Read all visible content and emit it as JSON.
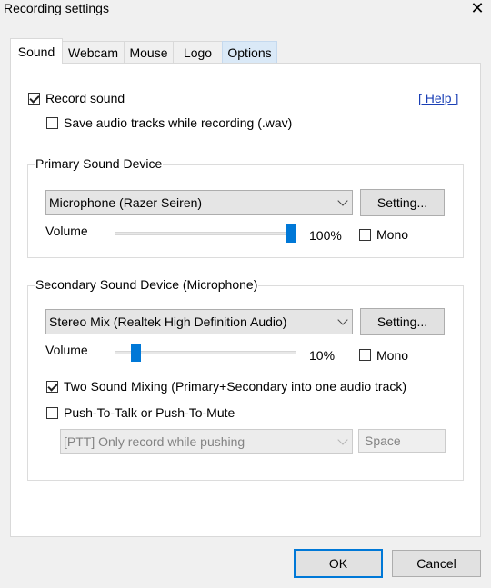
{
  "window": {
    "title": "Recording settings",
    "close_glyph": "✕"
  },
  "tabs": [
    {
      "label": "Sound",
      "active": true
    },
    {
      "label": "Webcam"
    },
    {
      "label": "Mouse"
    },
    {
      "label": "Logo"
    },
    {
      "label": "Options",
      "hover": true
    }
  ],
  "sound": {
    "record_sound": {
      "label": "Record sound",
      "checked": true
    },
    "save_wav": {
      "label": "Save audio tracks while recording (.wav)",
      "checked": false
    },
    "help_link": "[ Help ]",
    "primary": {
      "title": "Primary Sound Device",
      "device": "Microphone (Razer Seiren)",
      "setting_label": "Setting...",
      "volume_label": "Volume",
      "volume_value": "100%",
      "volume_level": 1.0,
      "mono": {
        "label": "Mono",
        "checked": false
      }
    },
    "secondary": {
      "title": "Secondary Sound Device (Microphone)",
      "device": "Stereo Mix (Realtek High Definition Audio)",
      "setting_label": "Setting...",
      "volume_label": "Volume",
      "volume_value": "10%",
      "volume_level": 0.1,
      "mono": {
        "label": "Mono",
        "checked": false
      },
      "two_sound_mixing": {
        "label": "Two Sound Mixing (Primary+Secondary into one audio track)",
        "checked": true
      },
      "push_to_talk": {
        "label": "Push-To-Talk or Push-To-Mute",
        "checked": false
      },
      "ptt_mode": "[PTT] Only record while pushing",
      "ptt_key": "Space"
    }
  },
  "footer": {
    "ok_label": "OK",
    "cancel_label": "Cancel"
  },
  "colors": {
    "accent": "#0078d7",
    "link": "#1a3fb5"
  }
}
